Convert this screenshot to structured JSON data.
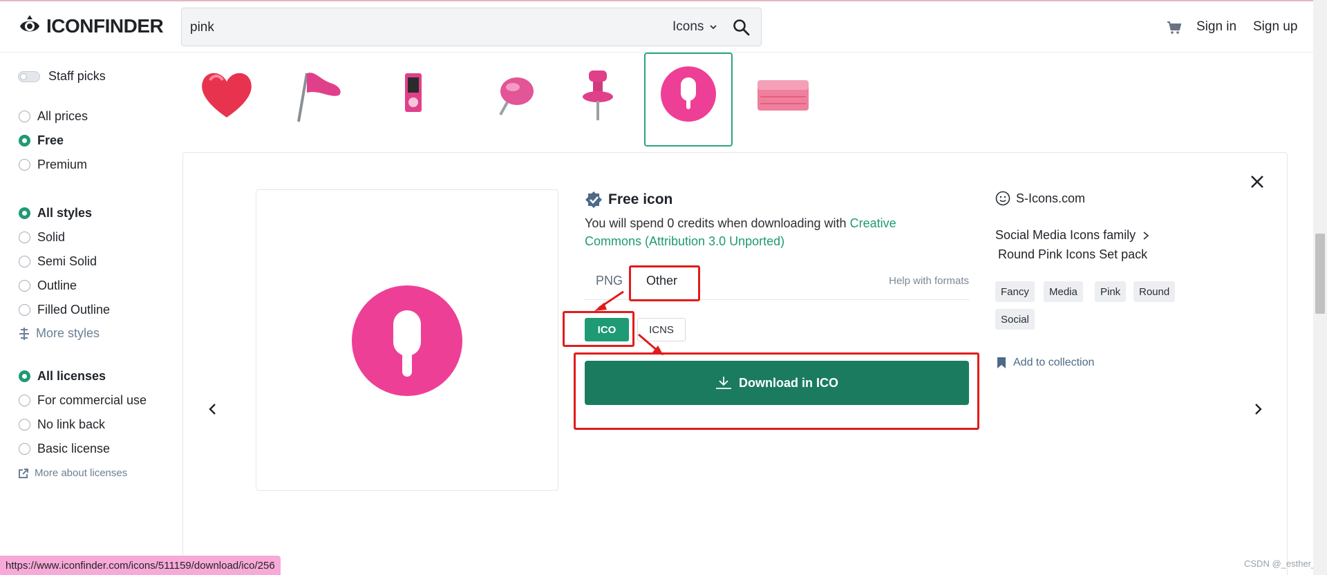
{
  "header": {
    "logo_text": "ICONFINDER",
    "search_value": "pink",
    "search_type": "Icons",
    "signin": "Sign in",
    "signup": "Sign up"
  },
  "sidebar": {
    "staff_picks": "Staff picks",
    "prices": [
      "All prices",
      "Free",
      "Premium"
    ],
    "styles": [
      "All styles",
      "Solid",
      "Semi Solid",
      "Outline",
      "Filled Outline"
    ],
    "more_styles": "More styles",
    "licenses": [
      "All licenses",
      "For commercial use",
      "No link back",
      "Basic license"
    ],
    "more_licenses": "More about licenses"
  },
  "detail": {
    "free_title": "Free icon",
    "spend_text": "You will spend 0 credits when downloading with",
    "license_link": "Creative Commons (Attribution 3.0 Unported)",
    "tab_png": "PNG",
    "tab_other": "Other",
    "help_formats": "Help with formats",
    "fmt_ico": "ICO",
    "fmt_icns": "ICNS",
    "download_label": "Download in ICO"
  },
  "info": {
    "author": "S-Icons.com",
    "family": "Social Media Icons family",
    "set": "Round Pink Icons Set pack",
    "tags": [
      "Fancy",
      "Media",
      "Pink",
      "Round",
      "Social"
    ],
    "add_collection": "Add to collection"
  },
  "status_url": "https://www.iconfinder.com/icons/511159/download/ico/256",
  "watermark": "CSDN @_esther_",
  "colors": {
    "accent_green": "#1e9a74",
    "download_green": "#1a7b5f",
    "icon_pink": "#ee3f96",
    "annotation_red": "#e21b1b"
  }
}
